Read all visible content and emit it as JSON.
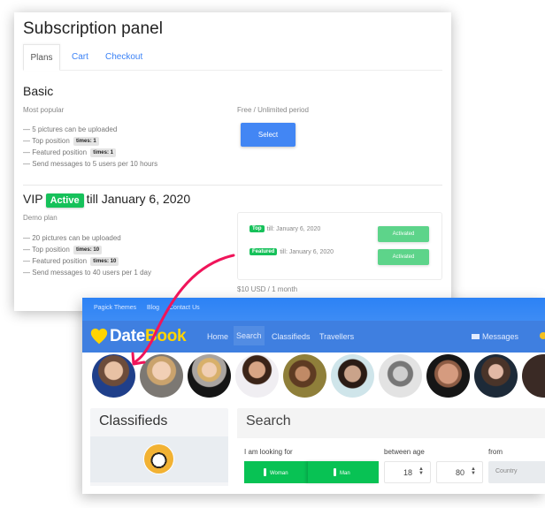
{
  "subscription_panel": {
    "title": "Subscription panel",
    "tabs": [
      {
        "label": "Plans",
        "active": true
      },
      {
        "label": "Cart",
        "active": false
      },
      {
        "label": "Checkout",
        "active": false
      }
    ],
    "basic_plan": {
      "name": "Basic",
      "subtitle": "Most popular",
      "price": "Free / Unlimited period",
      "select_label": "Select",
      "features": [
        {
          "text": "5 pictures can be uploaded"
        },
        {
          "text": "Top position",
          "badge": "times: 1"
        },
        {
          "text": "Featured position",
          "badge": "times: 1"
        },
        {
          "text": "Send messages to 5 users per 10 hours"
        }
      ]
    },
    "vip_plan": {
      "name": "VIP",
      "status_badge": "Active",
      "status_suffix": "till January 6, 2020",
      "subtitle": "Demo plan",
      "price": "$10 USD / 1 month",
      "features": [
        {
          "text": "20 pictures can be uploaded"
        },
        {
          "text": "Top position",
          "badge": "times: 10"
        },
        {
          "text": "Featured position",
          "badge": "times: 10"
        },
        {
          "text": "Send messages to 40 users per 1 day"
        }
      ],
      "addons": [
        {
          "badge": "Top",
          "text": "till: January 6, 2020",
          "button": "Activated"
        },
        {
          "badge": "Featured",
          "text": "till: January 6, 2020",
          "button": "Activated"
        }
      ]
    }
  },
  "site": {
    "topbar_links": [
      "Pagick Themes",
      "Blog",
      "Contact Us"
    ],
    "logo": {
      "part1": "Date",
      "part2": "Book",
      "icon": "heart-icon"
    },
    "nav_links": [
      "Home",
      "Search",
      "Classifieds",
      "Travellers"
    ],
    "active_nav": "Search",
    "messages_label": "Messages",
    "colors": {
      "topbar": "#2c82f5",
      "navbar": "#3f7fe0",
      "logo_accent": "#ffd400",
      "green": "#08c254",
      "arrow": "#f0145a"
    },
    "avatars": [
      {
        "alt": "profile-1"
      },
      {
        "alt": "profile-2"
      },
      {
        "alt": "profile-3"
      },
      {
        "alt": "profile-4"
      },
      {
        "alt": "profile-5"
      },
      {
        "alt": "profile-6"
      },
      {
        "alt": "profile-7"
      },
      {
        "alt": "profile-8"
      },
      {
        "alt": "profile-9"
      }
    ],
    "classifieds": {
      "title": "Classifieds"
    },
    "search": {
      "title": "Search",
      "looking_for_label": "I am looking for",
      "woman_label": "Woman",
      "man_label": "Man",
      "age_label": "between age",
      "age_min": "18",
      "age_max": "80",
      "from_label": "from",
      "country_placeholder": "Country"
    }
  }
}
